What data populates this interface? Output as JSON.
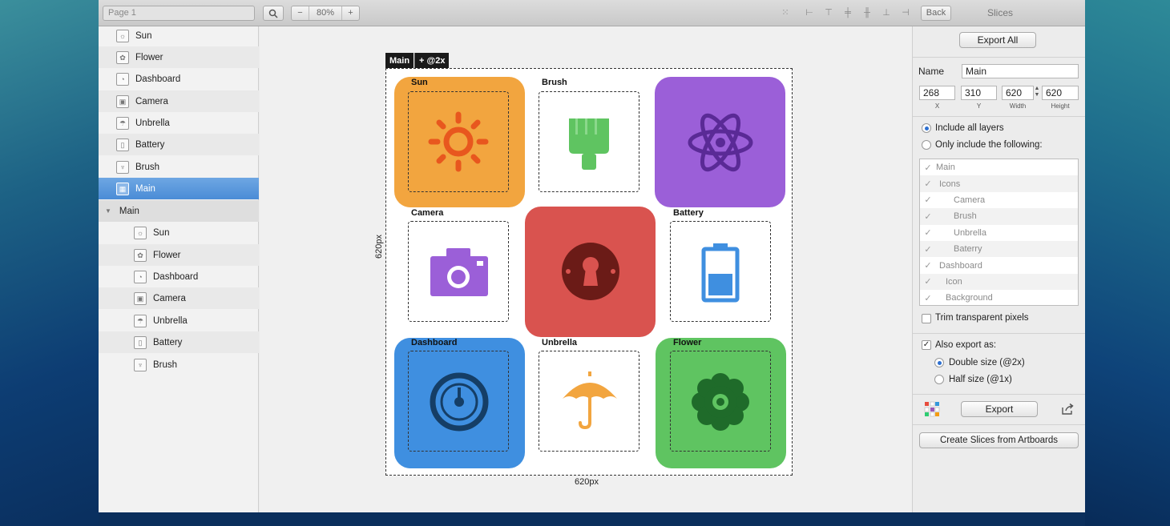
{
  "toolbar": {
    "page_select": "Page 1",
    "zoom_out": "−",
    "zoom_level": "80%",
    "zoom_in": "+",
    "back": "Back",
    "panel_title": "Slices"
  },
  "layers": {
    "top": [
      {
        "label": "Sun",
        "icon": "sun-icon"
      },
      {
        "label": "Flower",
        "icon": "flower-icon"
      },
      {
        "label": "Dashboard",
        "icon": "dashboard-icon"
      },
      {
        "label": "Camera",
        "icon": "camera-icon"
      },
      {
        "label": "Unbrella",
        "icon": "umbrella-icon"
      },
      {
        "label": "Battery",
        "icon": "battery-icon"
      },
      {
        "label": "Brush",
        "icon": "brush-icon"
      },
      {
        "label": "Main",
        "icon": "slice-icon"
      }
    ],
    "group": "Main",
    "children": [
      {
        "label": "Sun"
      },
      {
        "label": "Flower"
      },
      {
        "label": "Dashboard"
      },
      {
        "label": "Camera"
      },
      {
        "label": "Unbrella"
      },
      {
        "label": "Battery"
      },
      {
        "label": "Brush"
      }
    ]
  },
  "canvas": {
    "board_tag": "Main",
    "board_tag_2x": "+ @2x",
    "width_label": "620px",
    "height_label": "620px",
    "slice_labels": [
      "Sun",
      "Brush",
      "Camera",
      "Battery",
      "Dashboard",
      "Unbrella",
      "Flower"
    ],
    "colors": {
      "sun": "#f2a53f",
      "purple": "#9b5fd8",
      "red": "#d9534f",
      "blue": "#3f8fe0",
      "green": "#5fc461"
    }
  },
  "slices_panel": {
    "export_all": "Export All",
    "name_label": "Name",
    "name_value": "Main",
    "x": "268",
    "y": "310",
    "w": "620",
    "h": "620",
    "x_label": "X",
    "y_label": "Y",
    "w_label": "Width",
    "h_label": "Height",
    "include_all": "Include all layers",
    "only_include": "Only include the following:",
    "list": [
      "Main",
      "Icons",
      "Camera",
      "Brush",
      "Unbrella",
      "Baterry",
      "Dashboard",
      "Icon",
      "Background"
    ],
    "trim": "Trim transparent pixels",
    "also_export": "Also export as:",
    "double": "Double size (@2x)",
    "half": "Half size (@1x)",
    "export": "Export",
    "create": "Create Slices from Artboards"
  }
}
